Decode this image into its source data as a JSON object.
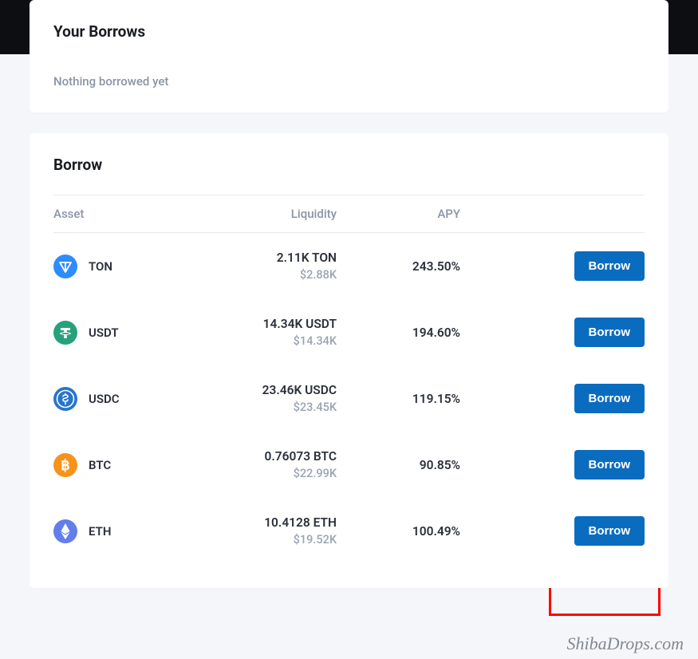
{
  "your_borrows": {
    "title": "Your Borrows",
    "empty_message": "Nothing borrowed yet"
  },
  "borrow": {
    "title": "Borrow",
    "columns": {
      "asset": "Asset",
      "liquidity": "Liquidity",
      "apy": "APY"
    },
    "action_label": "Borrow",
    "assets": [
      {
        "symbol": "TON",
        "liquidity_amount": "2.11K TON",
        "liquidity_usd": "$2.88K",
        "apy": "243.50%",
        "icon_bg": "#2d8cff",
        "icon_glyph": "ton"
      },
      {
        "symbol": "USDT",
        "liquidity_amount": "14.34K USDT",
        "liquidity_usd": "$14.34K",
        "apy": "194.60%",
        "icon_bg": "#26a17b",
        "icon_glyph": "usdt"
      },
      {
        "symbol": "USDC",
        "liquidity_amount": "23.46K USDC",
        "liquidity_usd": "$23.45K",
        "apy": "119.15%",
        "icon_bg": "#2775ca",
        "icon_glyph": "usdc"
      },
      {
        "symbol": "BTC",
        "liquidity_amount": "0.76073 BTC",
        "liquidity_usd": "$22.99K",
        "apy": "90.85%",
        "icon_bg": "#f7931a",
        "icon_glyph": "btc"
      },
      {
        "symbol": "ETH",
        "liquidity_amount": "10.4128 ETH",
        "liquidity_usd": "$19.52K",
        "apy": "100.49%",
        "icon_bg": "#627eea",
        "icon_glyph": "eth"
      }
    ]
  },
  "watermark": "ShibaDrops.com"
}
